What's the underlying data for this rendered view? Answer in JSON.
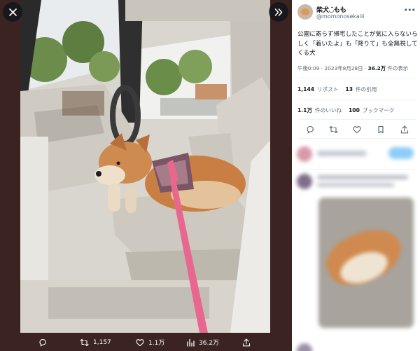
{
  "viewer": {
    "close_icon": "close-icon",
    "expand_icon": "chevron-double-right-icon",
    "actions": {
      "reply": {
        "icon": "reply-icon",
        "count": ""
      },
      "retweet": {
        "icon": "retweet-icon",
        "count": "1,157"
      },
      "like": {
        "icon": "heart-icon",
        "count": "1.1万"
      },
      "views": {
        "icon": "analytics-icon",
        "count": "36.2万"
      },
      "share": {
        "icon": "share-icon",
        "count": ""
      }
    }
  },
  "tweet": {
    "display_name": "柴犬◡̈もも",
    "handle": "@momonosekaiii",
    "text": "公園に寄らず帰宅したことが気に入らないらしく「着いたよ」も「降りて」も全無視してくる犬",
    "time": "午後0:09 · 2023年8月28日 · ",
    "views_value": "36.2万",
    "views_label": " 件の表示",
    "retweets_value": "1,144",
    "retweets_label": "リポスト",
    "quotes_value": "13",
    "quotes_label": "件の引用",
    "likes_value": "1.1万",
    "likes_label": "件のいいね",
    "bookmarks_value": "100",
    "bookmarks_label": "ブックマーク",
    "actions": [
      "reply-icon",
      "retweet-icon",
      "heart-icon",
      "bookmark-icon",
      "share-icon"
    ]
  },
  "colors": {
    "viewer_bg": "#3b2322",
    "accent": "#1d9bf0",
    "muted_text": "#536471"
  }
}
